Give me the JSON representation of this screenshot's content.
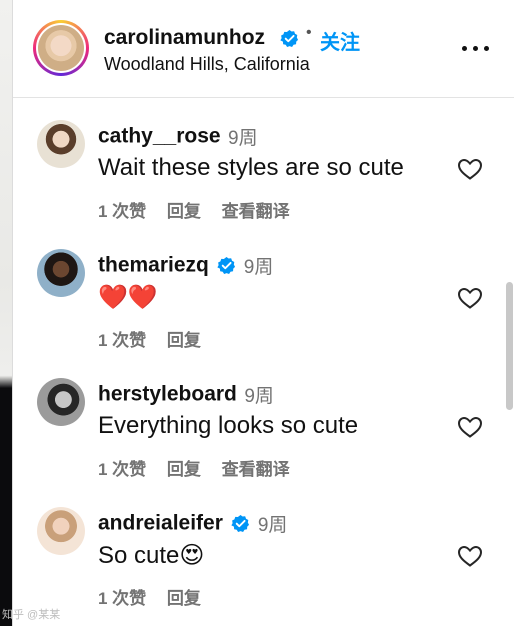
{
  "header": {
    "username": "carolinamunhoz",
    "separator": "•",
    "follow_label": "关注",
    "location": "Woodland Hills, California",
    "more_icon": "more-horizontal-icon"
  },
  "comments": [
    {
      "username": "cathy__rose",
      "verified": false,
      "time": "9周",
      "text": "Wait these styles are so cute",
      "likes": "1 次赞",
      "reply": "回复",
      "translate": "查看翻译"
    },
    {
      "username": "themariezq",
      "verified": true,
      "time": "9周",
      "text": "❤️❤️",
      "likes": "1 次赞",
      "reply": "回复",
      "translate": ""
    },
    {
      "username": "herstyleboard",
      "verified": false,
      "time": "9周",
      "text": "Everything looks so cute",
      "likes": "1 次赞",
      "reply": "回复",
      "translate": "查看翻译"
    },
    {
      "username": "andreialeifer",
      "verified": true,
      "time": "9周",
      "text": "So cute😍",
      "likes": "1 次赞",
      "reply": "回复",
      "translate": ""
    }
  ],
  "colors": {
    "accent": "#0095f6",
    "secondary_text": "#737373",
    "verified_badge": "#0095f6"
  },
  "watermark": "知乎 @某某"
}
